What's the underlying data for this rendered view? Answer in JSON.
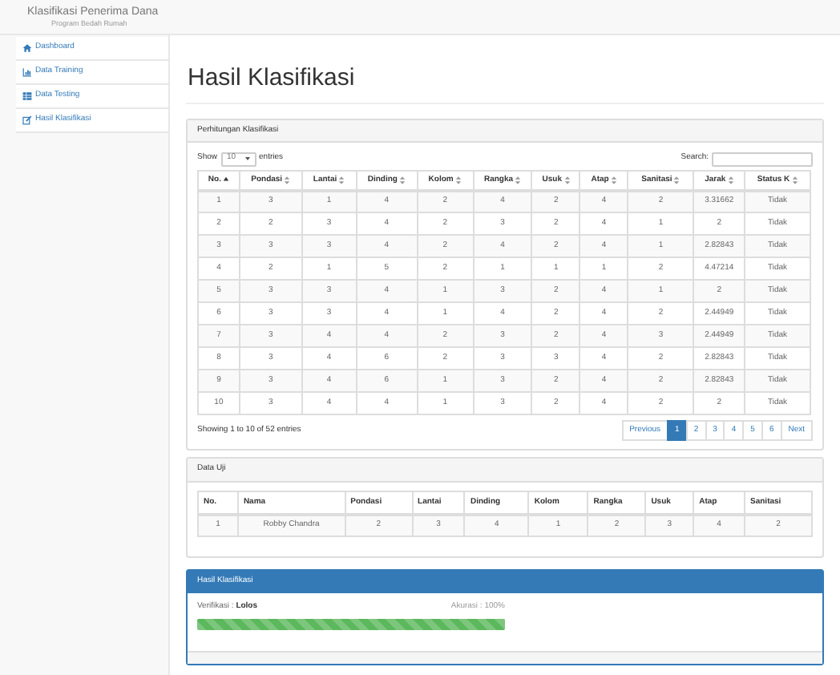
{
  "navbar": {
    "title": "Klasifikasi Penerima Dana",
    "subtitle": "Program Bedah Rumah"
  },
  "sidebar": {
    "items": [
      {
        "label": "Dashboard",
        "kind": "home"
      },
      {
        "label": "Data Training",
        "kind": "chart"
      },
      {
        "label": "Data Testing",
        "kind": "table"
      },
      {
        "label": "Hasil Klasifikasi",
        "kind": "edit"
      }
    ]
  },
  "page_title": "Hasil Klasifikasi",
  "perhitungan": {
    "title": "Perhitungan Klasifikasi",
    "show_label": "Show",
    "length_value": "10",
    "entries_label": "entries",
    "search_label": "Search:",
    "columns": [
      {
        "label": "No.",
        "kind": "sorted"
      },
      {
        "label": "Pondasi",
        "kind": "sortable"
      },
      {
        "label": "Lantai",
        "kind": "sortable"
      },
      {
        "label": "Dinding",
        "kind": "sortable"
      },
      {
        "label": "Kolom",
        "kind": "sortable"
      },
      {
        "label": "Rangka",
        "kind": "sortable"
      },
      {
        "label": "Usuk",
        "kind": "sortable"
      },
      {
        "label": "Atap",
        "kind": "sortable"
      },
      {
        "label": "Sanitasi",
        "kind": "sortable"
      },
      {
        "label": "Jarak",
        "kind": "sortable"
      },
      {
        "label": "Status K",
        "kind": "sortable"
      }
    ],
    "rows": [
      [
        "1",
        "3",
        "1",
        "4",
        "2",
        "4",
        "2",
        "4",
        "2",
        "3.31662",
        "Tidak"
      ],
      [
        "2",
        "2",
        "3",
        "4",
        "2",
        "3",
        "2",
        "4",
        "1",
        "2",
        "Tidak"
      ],
      [
        "3",
        "3",
        "3",
        "4",
        "2",
        "4",
        "2",
        "4",
        "1",
        "2.82843",
        "Tidak"
      ],
      [
        "4",
        "2",
        "1",
        "5",
        "2",
        "1",
        "1",
        "1",
        "2",
        "4.47214",
        "Tidak"
      ],
      [
        "5",
        "3",
        "3",
        "4",
        "1",
        "3",
        "2",
        "4",
        "1",
        "2",
        "Tidak"
      ],
      [
        "6",
        "3",
        "3",
        "4",
        "1",
        "4",
        "2",
        "4",
        "2",
        "2.44949",
        "Tidak"
      ],
      [
        "7",
        "3",
        "4",
        "4",
        "2",
        "3",
        "2",
        "4",
        "3",
        "2.44949",
        "Tidak"
      ],
      [
        "8",
        "3",
        "4",
        "6",
        "2",
        "3",
        "3",
        "4",
        "2",
        "2.82843",
        "Tidak"
      ],
      [
        "9",
        "3",
        "4",
        "6",
        "1",
        "3",
        "2",
        "4",
        "2",
        "2.82843",
        "Tidak"
      ],
      [
        "10",
        "3",
        "4",
        "4",
        "1",
        "3",
        "2",
        "4",
        "2",
        "2",
        "Tidak"
      ]
    ],
    "info": "Showing 1 to 10 of 52 entries",
    "pagination": [
      {
        "label": "Previous",
        "selected": false
      },
      {
        "label": "1",
        "selected": true
      },
      {
        "label": "2",
        "selected": false
      },
      {
        "label": "3",
        "selected": false
      },
      {
        "label": "4",
        "selected": false
      },
      {
        "label": "5",
        "selected": false
      },
      {
        "label": "6",
        "selected": false
      },
      {
        "label": "Next",
        "selected": false
      }
    ]
  },
  "data_uji": {
    "title": "Data Uji",
    "columns": [
      "No.",
      "Nama",
      "Pondasi",
      "Lantai",
      "Dinding",
      "Kolom",
      "Rangka",
      "Usuk",
      "Atap",
      "Sanitasi"
    ],
    "rows": [
      [
        "1",
        "Robby Chandra",
        "2",
        "3",
        "4",
        "1",
        "2",
        "3",
        "4",
        "2"
      ]
    ]
  },
  "hasil": {
    "title": "Hasil Klasifikasi",
    "verifikasi_label": "Verifikasi :",
    "verifikasi_value": "Lolos",
    "akurasi": "Akurasi : 100%",
    "level": 1
  }
}
